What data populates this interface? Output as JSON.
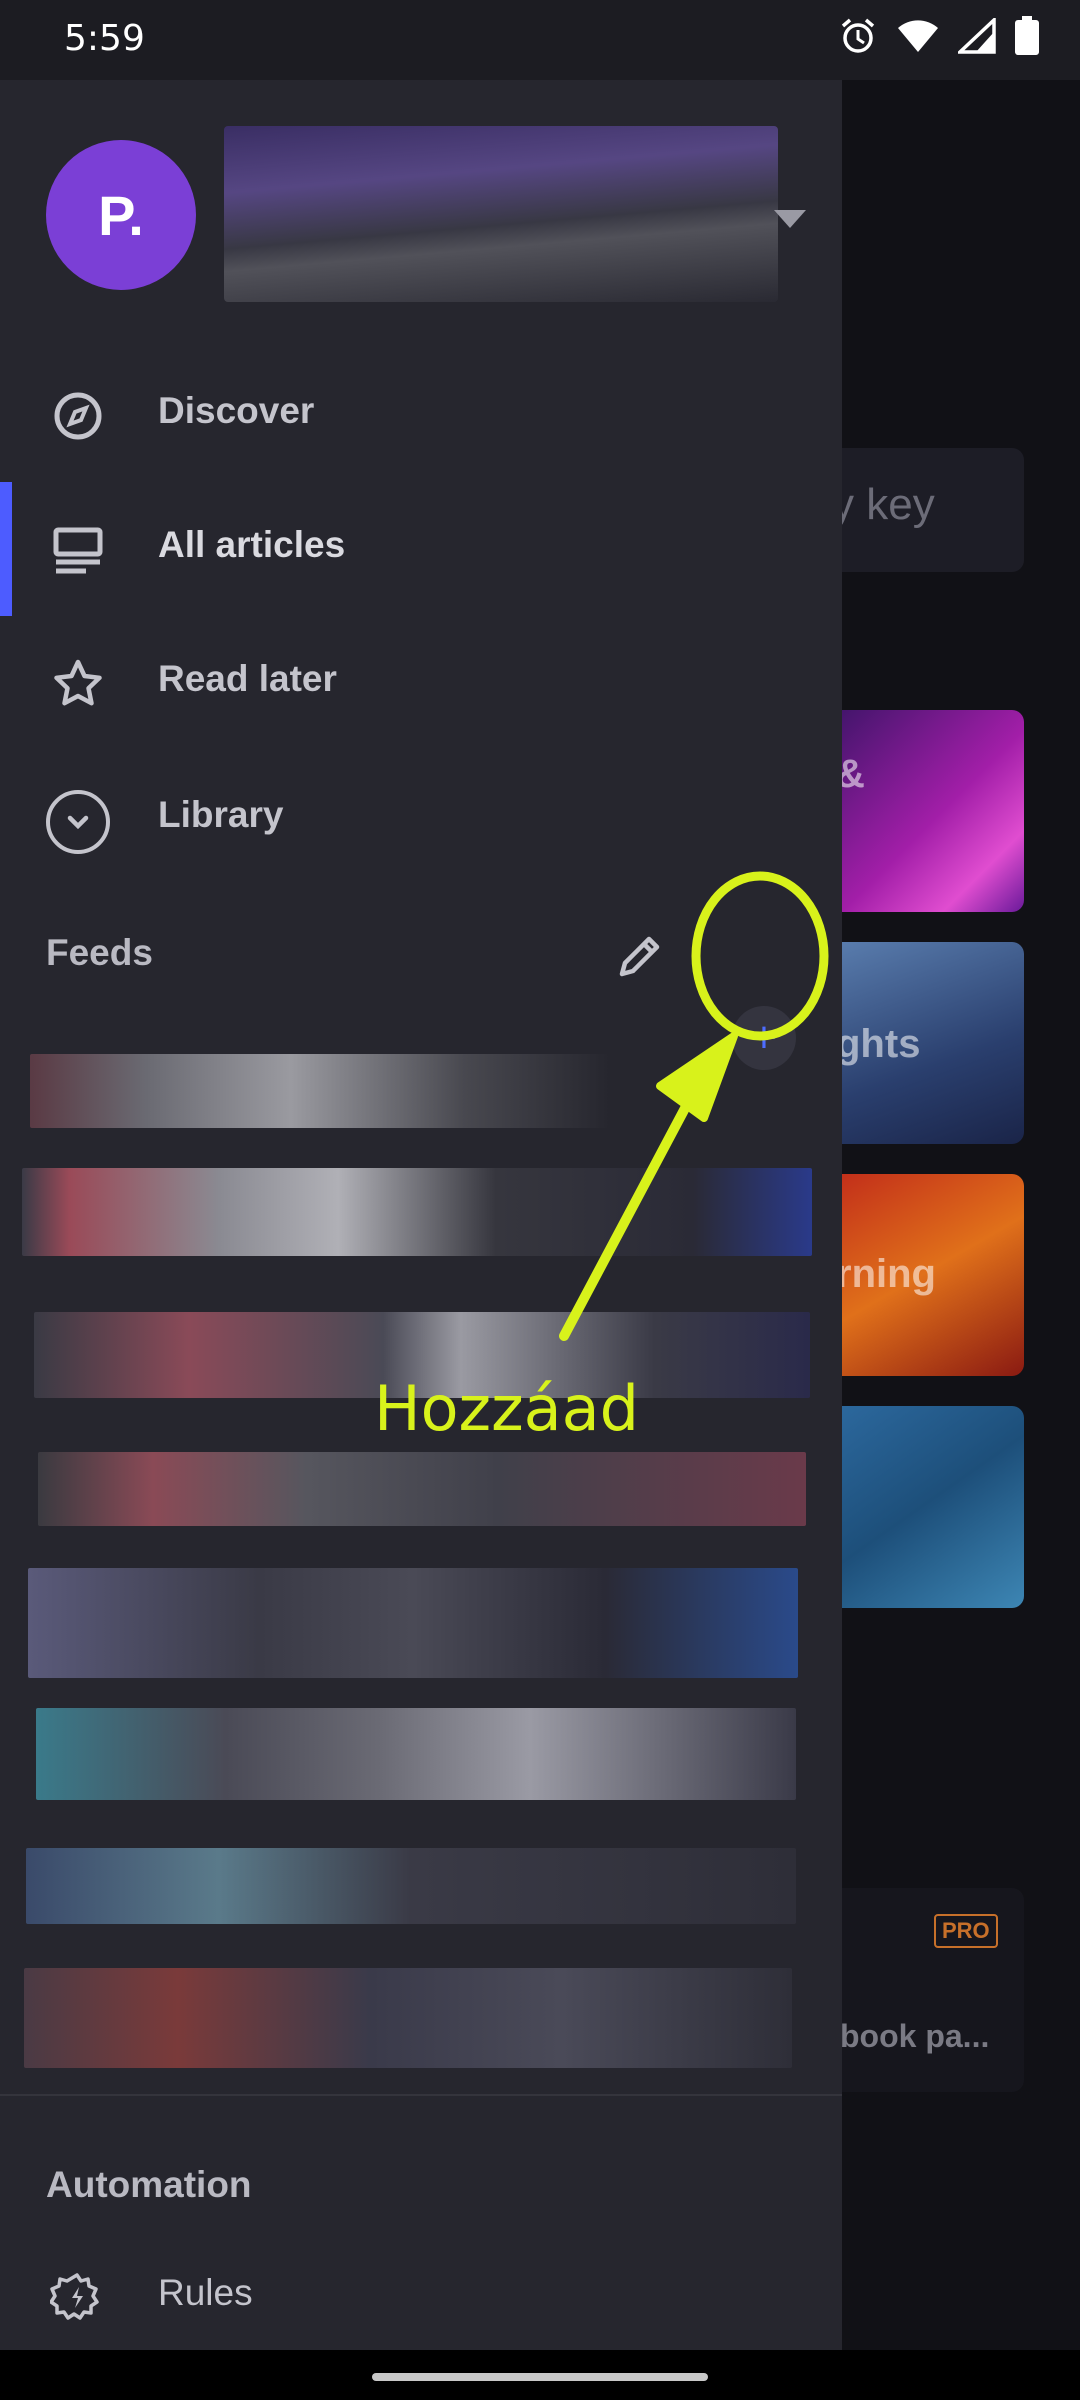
{
  "status_bar": {
    "time": "5:59",
    "icons": [
      "alarm-icon",
      "wifi-icon",
      "signal-icon",
      "battery-icon"
    ]
  },
  "drawer": {
    "avatar_initial": "P.",
    "nav_items": [
      {
        "label": "Discover",
        "icon": "compass-icon",
        "active": false
      },
      {
        "label": "All articles",
        "icon": "articles-icon",
        "active": true
      },
      {
        "label": "Read later",
        "icon": "star-icon",
        "active": false
      },
      {
        "label": "Library",
        "icon": "chevron-down-circle-icon",
        "active": false
      }
    ],
    "feeds_section": {
      "title": "Feeds",
      "edit_icon": "pencil-icon",
      "add_label": "+"
    },
    "automation_section": {
      "title": "Automation",
      "rules_label": "Rules",
      "rules_icon": "rules-gear-icon"
    }
  },
  "background_app": {
    "search_fragment": "y key",
    "card_fragments": [
      "&",
      "ghts",
      "rning"
    ],
    "pro_badge": "PRO",
    "book_fragment": "book pa..."
  },
  "annotation": {
    "label": "Hozzáad",
    "color": "#d8f21b"
  },
  "colors": {
    "drawer_bg": "#26262e",
    "accent": "#4d5cff",
    "avatar": "#7b3fd6"
  }
}
